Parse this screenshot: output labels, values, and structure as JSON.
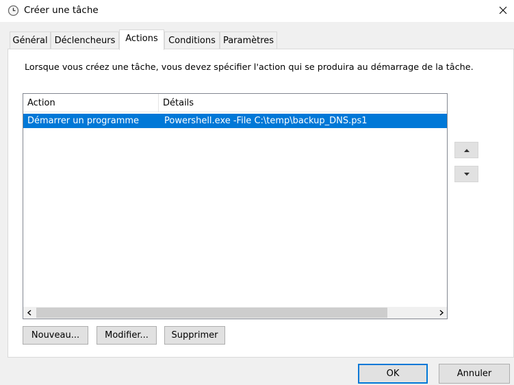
{
  "window": {
    "title": "Créer une tâche",
    "icon": "clock-icon",
    "close_icon": "close-icon"
  },
  "tabs": [
    {
      "label": "Général",
      "active": false
    },
    {
      "label": "Déclencheurs",
      "active": false
    },
    {
      "label": "Actions",
      "active": true
    },
    {
      "label": "Conditions",
      "active": false
    },
    {
      "label": "Paramètres",
      "active": false
    }
  ],
  "actions_tab": {
    "instruction": "Lorsque vous créez une tâche, vous devez spécifier l'action qui se produira au démarrage de la tâche.",
    "table": {
      "columns": [
        "Action",
        "Détails"
      ],
      "rows": [
        {
          "action": "Démarrer un programme",
          "details": "Powershell.exe -File C:\\temp\\backup_DNS.ps1",
          "selected": true
        }
      ]
    },
    "move_up_icon": "triangle-up-icon",
    "move_down_icon": "triangle-down-icon",
    "buttons": {
      "new": "Nouveau...",
      "edit": "Modifier...",
      "delete": "Supprimer"
    }
  },
  "footer": {
    "ok": "OK",
    "cancel": "Annuler"
  },
  "colors": {
    "selection": "#0078d7",
    "default_button_border": "#0078d7"
  }
}
